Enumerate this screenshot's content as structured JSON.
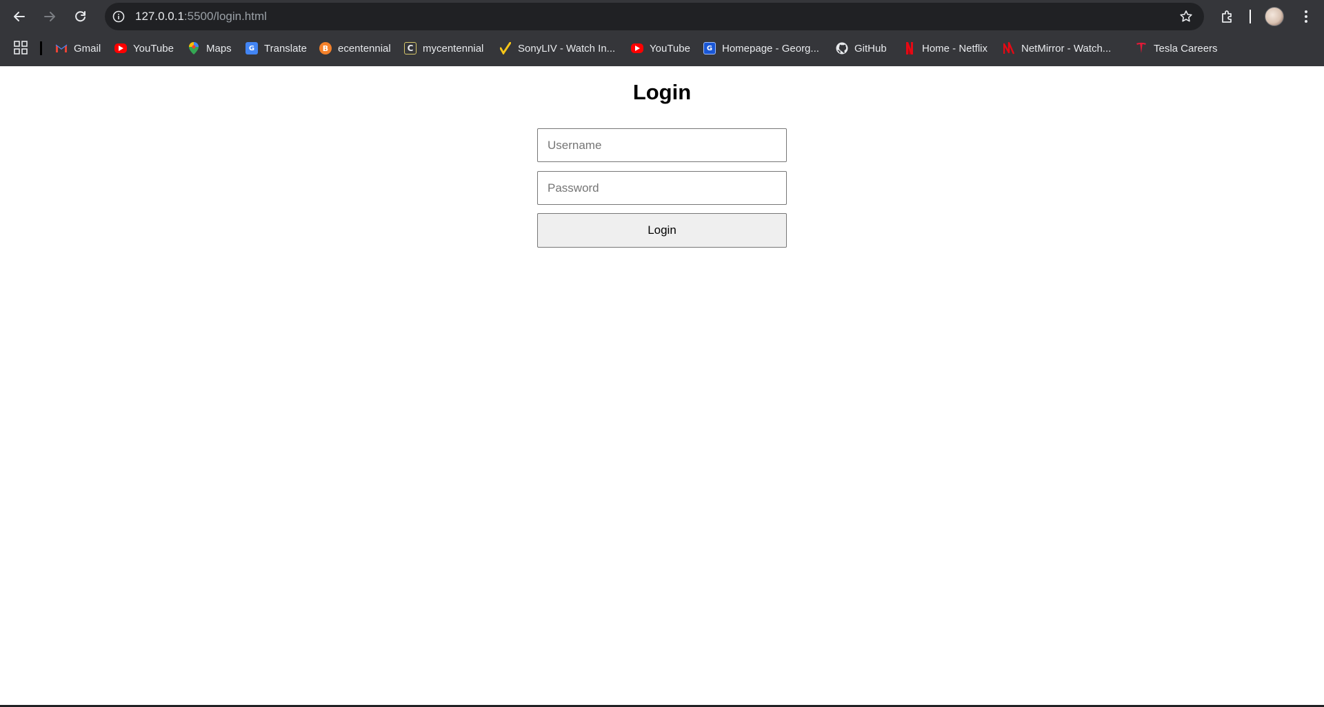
{
  "browser": {
    "url_host": "127.0.0.1",
    "url_rest": ":5500/login.html",
    "bookmarks": [
      {
        "label": "Gmail",
        "icon": "gmail-icon"
      },
      {
        "label": "YouTube",
        "icon": "youtube-icon"
      },
      {
        "label": "Maps",
        "icon": "maps-icon"
      },
      {
        "label": "Translate",
        "icon": "translate-icon"
      },
      {
        "label": "ecentennial",
        "icon": "ecentennial-icon"
      },
      {
        "label": "mycentennial",
        "icon": "mycentennial-icon"
      },
      {
        "label": "SonyLIV - Watch In...",
        "icon": "sonyliv-icon"
      },
      {
        "label": "YouTube",
        "icon": "youtube-icon"
      },
      {
        "label": "Homepage - Georg...",
        "icon": "georgian-icon"
      },
      {
        "label": "GitHub",
        "icon": "github-icon"
      },
      {
        "label": "Home - Netflix",
        "icon": "netflix-icon"
      },
      {
        "label": "NetMirror - Watch...",
        "icon": "netmirror-icon"
      },
      {
        "label": "Tesla Careers",
        "icon": "tesla-icon"
      }
    ]
  },
  "login": {
    "title": "Login",
    "username_placeholder": "Username",
    "password_placeholder": "Password",
    "button_label": "Login"
  },
  "colors": {
    "chrome_bg": "#35363a",
    "omnibox_bg": "#202124",
    "youtube_red": "#ff0000",
    "netflix_red": "#e50914",
    "button_bg": "#efefef"
  }
}
